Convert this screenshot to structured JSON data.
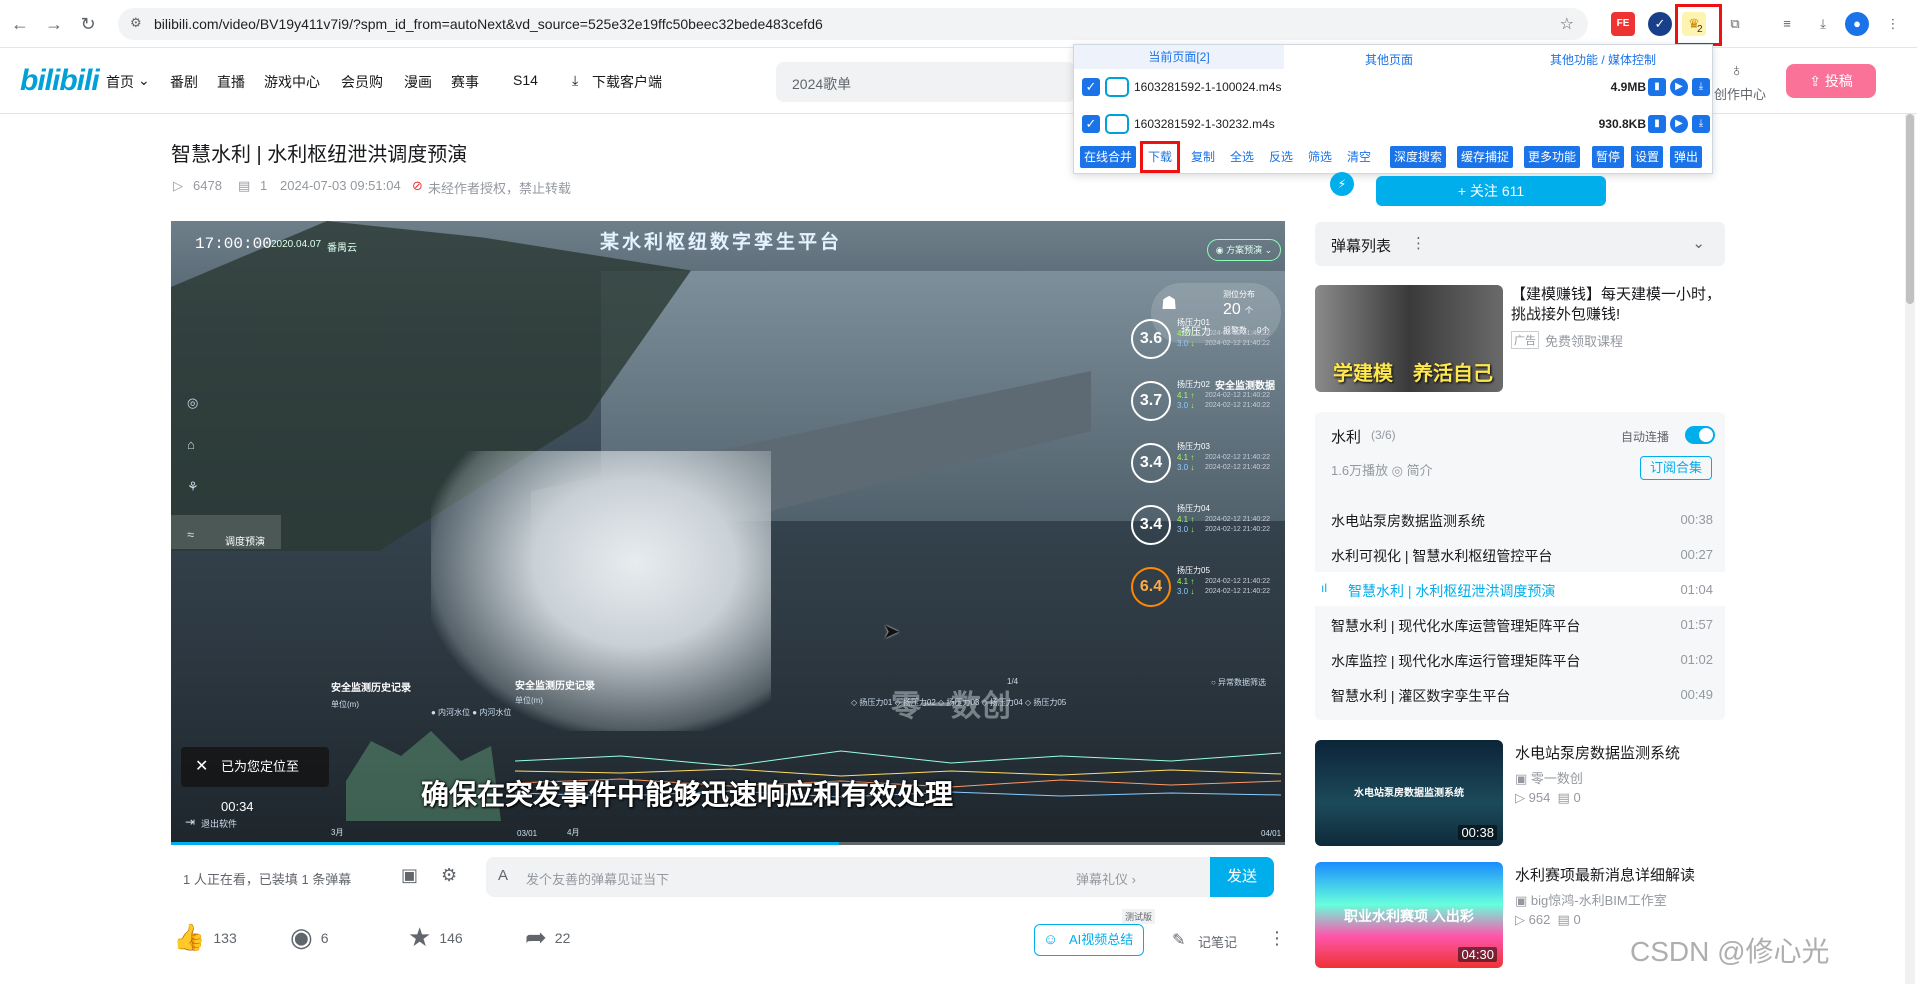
{
  "browser": {
    "url": "bilibili.com/video/BV19y411v7i9/?spm_id_from=autoNext&vd_source=525e32e19ffc50beec32bede483cefd6",
    "ext_badge": "2"
  },
  "header": {
    "logo": "bilibili",
    "nav": [
      "首页",
      "番剧",
      "直播",
      "游戏中心",
      "会员购",
      "漫画",
      "赛事",
      "S14",
      "下载客户端"
    ],
    "search_placeholder": "2024歌单",
    "creator_center": "创作中心",
    "upload_label": "投稿"
  },
  "popup": {
    "tabs": [
      "当前页面[2]",
      "其他页面",
      "其他功能 / 媒体控制"
    ],
    "files": [
      {
        "name": "1603281592-1-100024.m4s",
        "size": "4.9MB"
      },
      {
        "name": "1603281592-1-30232.m4s",
        "size": "930.8KB"
      }
    ],
    "buttons": [
      "在线合并",
      "下载",
      "复制",
      "全选",
      "反选",
      "筛选",
      "清空",
      "深度搜索",
      "缓存捕捉",
      "更多功能",
      "暂停",
      "设置",
      "弹出"
    ]
  },
  "video": {
    "title": "智慧水利 | 水利枢纽泄洪调度预演",
    "views": "6478",
    "danmaku": "1",
    "date": "2024-07-03 09:51:04",
    "copyright": "未经作者授权，禁止转载",
    "progress_fraction": 0.6
  },
  "player": {
    "title": "某水利枢纽数字孪生平台",
    "time": "17:00:00",
    "date": "2020.04.07",
    "location": "番禺云",
    "plan_label": "方案预演",
    "gauge_label": "扬压力",
    "gauge_value": "20",
    "gauge_unit": "个",
    "gauge_top": "测位分布",
    "gauge_bottom": "报警数",
    "gauge_alarm": "0个",
    "safety_header": "安全监测数据",
    "metrics": [
      {
        "label": "扬压力01",
        "value": "3.6",
        "a": "4.1",
        "b": "3.0",
        "date1": "2024-02-12 21:40:22",
        "date2": "2024-02-12 21:40:22"
      },
      {
        "label": "扬压力02",
        "value": "3.7",
        "a": "4.1",
        "b": "3.0",
        "date1": "2024-02-12 21:40:22",
        "date2": "2024-02-12 21:40:22"
      },
      {
        "label": "扬压力03",
        "value": "3.4",
        "a": "4.1",
        "b": "3.0",
        "date1": "2024-02-12 21:40:22",
        "date2": "2024-02-12 21:40:22"
      },
      {
        "label": "扬压力04",
        "value": "3.4",
        "a": "4.1",
        "b": "3.0",
        "date1": "2024-02-12 21:40:22",
        "date2": "2024-02-12 21:40:22"
      },
      {
        "label": "扬压力05",
        "value": "6.4",
        "a": "4.1",
        "b": "3.0",
        "date1": "2024-02-12 21:40:22",
        "date2": "2024-02-12 21:40:22"
      }
    ],
    "sidenav_label": "调度预演",
    "chart1_title": "安全监测历史记录",
    "chart1_unit": "单位(m)",
    "chart1_legend": "● 内河水位  ● 内河水位",
    "chart2_title": "安全监测历史记录",
    "chart2_unit": "单位(m)",
    "chart2_legend": "◇ 扬压力01  ◇ 扬压力02  ◇ 扬压力03  ◇ 扬压力04  ◇ 扬压力05",
    "anomaly_label": "○ 异常数据筛选",
    "page_ind": "1/4",
    "watermark": "零一数创",
    "subtitle": "确保在突发事件中能够迅速响应和有效处理",
    "toast": "已为您定位至00:34",
    "exit_label": "退出软件",
    "axis1_start": "3月",
    "axis1_end": "4月",
    "axis2_start": "03/01",
    "axis2_end": "04/01"
  },
  "danmaku_bar": {
    "info": "1 人正在看，已装填 1 条弹幕",
    "placeholder": "发个友善的弹幕见证当下",
    "etiquette": "弹幕礼仪 ›",
    "send": "发送"
  },
  "actions": {
    "like": "133",
    "coin": "6",
    "fav": "146",
    "share": "22",
    "ai_summary": "AI视频总结",
    "trial": "测试版",
    "notes": "记笔记"
  },
  "sidebar": {
    "follow": "+ 关注 611",
    "danmaku_list": "弹幕列表",
    "ad_title": "【建模赚钱】每天建模一小时，挑战接外包赚钱!",
    "ad_tag": "广告",
    "ad_sub": "免费领取课程",
    "ad_text1": "学建模",
    "ad_text2": "养活自己",
    "series_name": "水利",
    "series_count": "(3/6)",
    "autoplay": "自动连播",
    "series_stats": "1.6万播放  ◎ 简介",
    "subscribe": "订阅合集",
    "episodes": [
      {
        "title": "水电站泵房数据监测系统",
        "dur": "00:38"
      },
      {
        "title": "水利可视化 | 智慧水利枢纽管控平台",
        "dur": "00:27"
      },
      {
        "title": "智慧水利 | 水利枢纽泄洪调度预演",
        "dur": "01:04"
      },
      {
        "title": "智慧水利 | 现代化水库运营管理矩阵平台",
        "dur": "01:57"
      },
      {
        "title": "水库监控 | 现代化水库运行管理矩阵平台",
        "dur": "01:02"
      },
      {
        "title": "智慧水利 | 灌区数字孪生平台",
        "dur": "00:49"
      }
    ],
    "recs": [
      {
        "title": "水电站泵房数据监测系统",
        "up": "零一数创",
        "plays": "954",
        "dm": "0",
        "dur": "00:38",
        "thumb_text": "水电站泵房数据监测系统"
      },
      {
        "title": "水利赛项最新消息详细解读",
        "up": "big惊鸿-水利BIM工作室",
        "plays": "662",
        "dm": "0",
        "dur": "04:30",
        "thumb_text": "职业水利赛项 入出彩"
      }
    ]
  },
  "watermark": "CSDN @修心光"
}
